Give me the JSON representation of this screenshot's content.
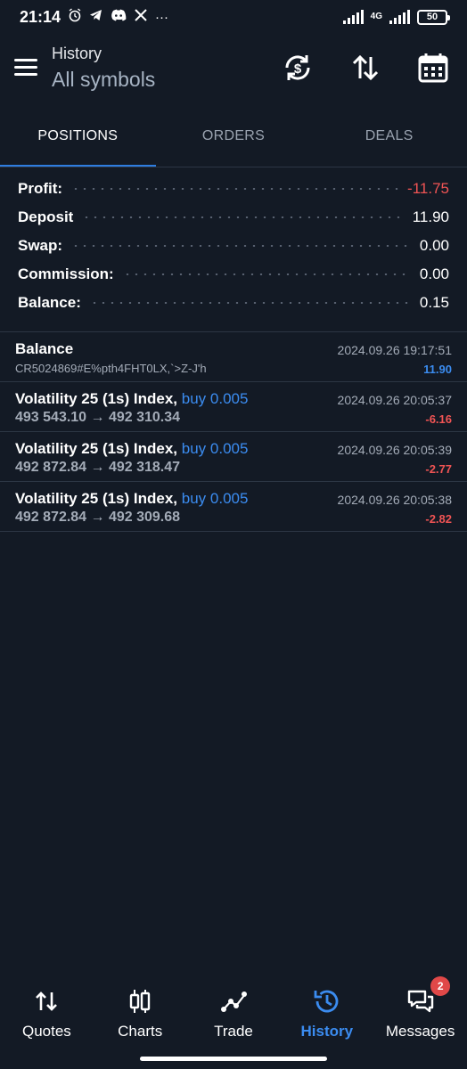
{
  "status_bar": {
    "time": "21:14",
    "network": "4G",
    "battery": "50",
    "icons": [
      "alarm-icon",
      "telegram-icon",
      "discord-icon",
      "x-icon",
      "more-dots-icon"
    ],
    "more": "···"
  },
  "header": {
    "title": "History",
    "subtitle": "All symbols",
    "icons": [
      "currency-exchange-icon",
      "sort-icon",
      "calendar-icon"
    ]
  },
  "tabs": [
    {
      "label": "POSITIONS",
      "active": true
    },
    {
      "label": "ORDERS",
      "active": false
    },
    {
      "label": "DEALS",
      "active": false
    }
  ],
  "summary": [
    {
      "label": "Profit:",
      "value": "-11.75",
      "negative": true
    },
    {
      "label": "Deposit",
      "value": "11.90",
      "negative": false
    },
    {
      "label": "Swap:",
      "value": "0.00",
      "negative": false
    },
    {
      "label": "Commission:",
      "value": "0.00",
      "negative": false
    },
    {
      "label": "Balance:",
      "value": "0.15",
      "negative": false
    }
  ],
  "history": [
    {
      "name": "Balance",
      "side": "",
      "sub": "CR5024869#E%pth4FHT0LX,`>Z-J'h",
      "date": "2024.09.26 19:17:51",
      "amount": "11.90",
      "amount_color": "#3b8cf0"
    },
    {
      "name": "Volatility 25 (1s) Index,",
      "side": "buy 0.005",
      "sub": "493 543.10 → 492 310.34",
      "date": "2024.09.26 20:05:37",
      "amount": "-6.16",
      "amount_color": "#f05454"
    },
    {
      "name": "Volatility 25 (1s) Index,",
      "side": "buy 0.005",
      "sub": "492 872.84 → 492 318.47",
      "date": "2024.09.26 20:05:39",
      "amount": "-2.77",
      "amount_color": "#f05454"
    },
    {
      "name": "Volatility 25 (1s) Index,",
      "side": "buy 0.005",
      "sub": "492 872.84 → 492 309.68",
      "date": "2024.09.26 20:05:38",
      "amount": "-2.82",
      "amount_color": "#f05454"
    }
  ],
  "bottom_nav": [
    {
      "label": "Quotes",
      "icon": "quotes-arrows-icon",
      "active": false
    },
    {
      "label": "Charts",
      "icon": "candlestick-icon",
      "active": false
    },
    {
      "label": "Trade",
      "icon": "trade-line-icon",
      "active": false
    },
    {
      "label": "History",
      "icon": "history-clock-icon",
      "active": true
    },
    {
      "label": "Messages",
      "icon": "messages-icon",
      "active": false,
      "badge": "2"
    }
  ],
  "colors": {
    "background": "#131a25",
    "accent": "#2e7de0",
    "negative": "#f05454",
    "positive": "#3b8cf0"
  }
}
